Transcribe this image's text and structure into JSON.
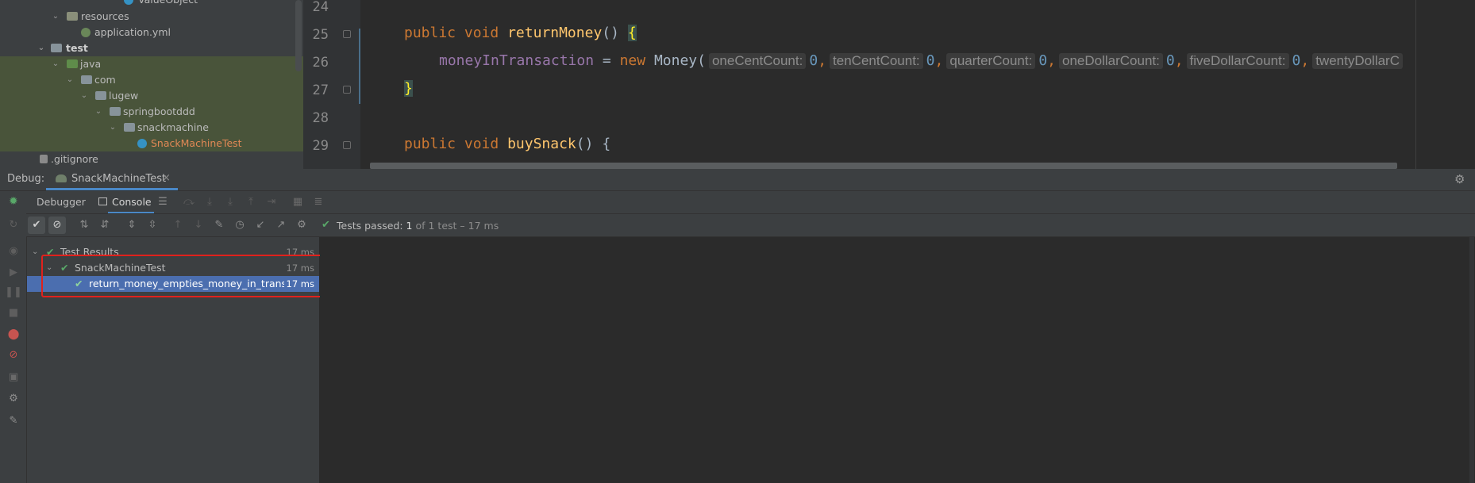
{
  "project_tree": {
    "items": [
      {
        "label": "ValueObject"
      },
      {
        "label": "resources"
      },
      {
        "label": "application.yml"
      },
      {
        "label": "test"
      },
      {
        "label": "java"
      },
      {
        "label": "com"
      },
      {
        "label": "lugew"
      },
      {
        "label": "springbootddd"
      },
      {
        "label": "snackmachine"
      },
      {
        "label": "SnackMachineTest"
      },
      {
        "label": ".gitignore"
      }
    ]
  },
  "editor": {
    "line_numbers": [
      "24",
      "25",
      "26",
      "27",
      "28",
      "29"
    ],
    "line25": {
      "kw1": "public",
      "kw2": "void",
      "name": "returnMoney",
      "paren": "()",
      "brace": "{"
    },
    "line26": {
      "field": "moneyInTransaction",
      "assign": " = ",
      "kw_new": "new",
      "ctor": " Money(",
      "args": [
        {
          "hint": "oneCentCount:",
          "value": "0",
          "sep": ","
        },
        {
          "hint": "tenCentCount:",
          "value": "0",
          "sep": ","
        },
        {
          "hint": "quarterCount:",
          "value": "0",
          "sep": ","
        },
        {
          "hint": "oneDollarCount:",
          "value": "0",
          "sep": ","
        },
        {
          "hint": "fiveDollarCount:",
          "value": "0",
          "sep": ","
        },
        {
          "hint": "twentyDollarC",
          "value": "",
          "sep": ""
        }
      ]
    },
    "line27": {
      "brace": "}"
    },
    "line29": {
      "kw1": "public",
      "kw2": "void",
      "name": "buySnack",
      "paren": "()",
      "brace": "{"
    }
  },
  "debug_bar": {
    "label": "Debug:",
    "tab_title": "SnackMachineTest",
    "close": "×"
  },
  "sub_tabs": {
    "debugger": "Debugger",
    "console": "Console"
  },
  "toolbar": {
    "status_prefix": "Tests passed:",
    "status_count": "1",
    "status_suffix": "of 1 test – 17 ms"
  },
  "results": {
    "items": [
      {
        "label": "Test Results",
        "time": "17 ms"
      },
      {
        "label": "SnackMachineTest",
        "time": "17 ms"
      },
      {
        "label": "return_money_empties_money_in_transactio",
        "time": "17 ms"
      }
    ]
  },
  "colors": {
    "accent": "#4a88c7",
    "pass": "#59a869",
    "highlight_box": "#e0211c",
    "selection": "#4b6eaf"
  }
}
